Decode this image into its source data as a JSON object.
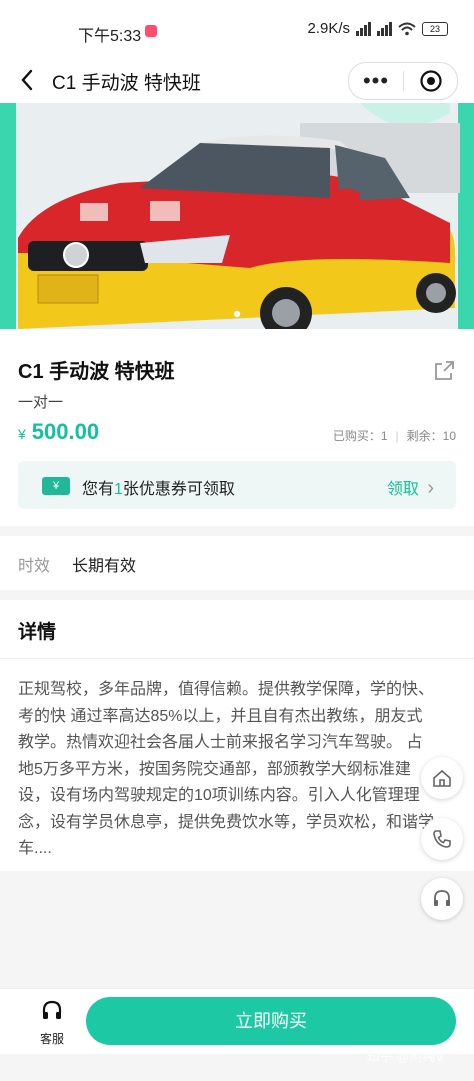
{
  "status_bar": {
    "time": "下午5:33",
    "network_speed": "2.9K/s",
    "battery": "23"
  },
  "nav": {
    "title": "C1 手动波 特快班",
    "more_label": "•••"
  },
  "product": {
    "title": "C1 手动波 特快班",
    "subtitle": "一对一",
    "currency": "¥",
    "price": "500.00",
    "purchased": "已购买：1",
    "remaining": "剩余：10",
    "stats_separator": "|"
  },
  "coupon": {
    "tag": "¥",
    "text_prefix": "您有",
    "count": "1",
    "text_suffix": "张优惠券可领取",
    "claim_label": "领取",
    "chevron": "›"
  },
  "validity": {
    "label": "时效",
    "value": "长期有效"
  },
  "details": {
    "heading": "详情",
    "body": "正规驾校，多年品牌，值得信赖。提供教学保障，学的快、考的快 通过率高达85%以上，并且自有杰出教练，朋友式教学。热情欢迎社会各届人士前来报名学习汽车驾驶。 占地5万多平方米，按国务院交通部，部颁教学大纲标准建设，设有场内驾驶规定的10项训练内容。引入人化管理理念，设有学员休息亭，提供免费饮水等，学员欢松，和谐学车...."
  },
  "bottom": {
    "customer_service_label": "客服",
    "buy_label": "立即购买",
    "watermark": "知乎 @阿纯V"
  },
  "colors": {
    "accent": "#1dc9a4",
    "price": "#12c29a",
    "car_red": "#d8262b",
    "car_yellow": "#f2c81b"
  }
}
